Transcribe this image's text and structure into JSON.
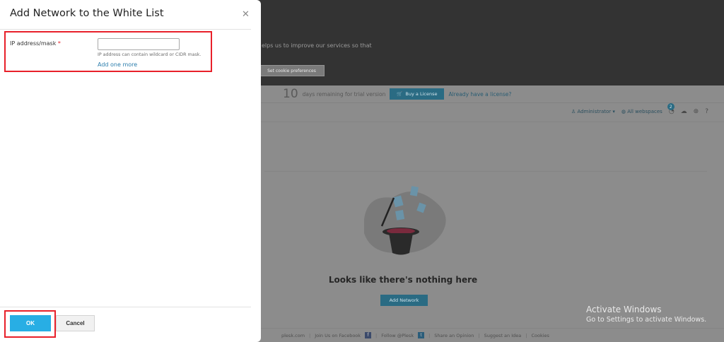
{
  "modal": {
    "title": "Add Network to the White List",
    "close_icon": "close-icon",
    "field_label": "IP address/mask",
    "required_mark": "*",
    "ip_value": "",
    "hint": "IP address can contain wildcard or CIDR mask.",
    "add_more": "Add one more",
    "ok_label": "OK",
    "cancel_label": "Cancel"
  },
  "background": {
    "cookie_text": "elps us to improve our services so that",
    "cookie_button": "Set cookie preferences",
    "trial_days": "10",
    "trial_text": "days remaining for trial version",
    "buy_license": "Buy a License",
    "have_license": "Already have a license?",
    "user": "Administrator",
    "webspaces": "All webspaces",
    "notification_count": "2",
    "empty_title": "Looks like there's nothing here",
    "add_network": "Add Network",
    "footer": {
      "plesk": "plesk.com",
      "join_facebook": "Join Us on Facebook",
      "follow": "Follow @Plesk",
      "share": "Share an Opinion",
      "suggest": "Suggest an Idea",
      "cookies": "Cookies"
    }
  },
  "watermark": {
    "line1": "Activate Windows",
    "line2": "Go to Settings to activate Windows."
  },
  "colors": {
    "highlight": "#e8202a",
    "primary_button": "#28aee4",
    "link": "#2b7dac"
  }
}
